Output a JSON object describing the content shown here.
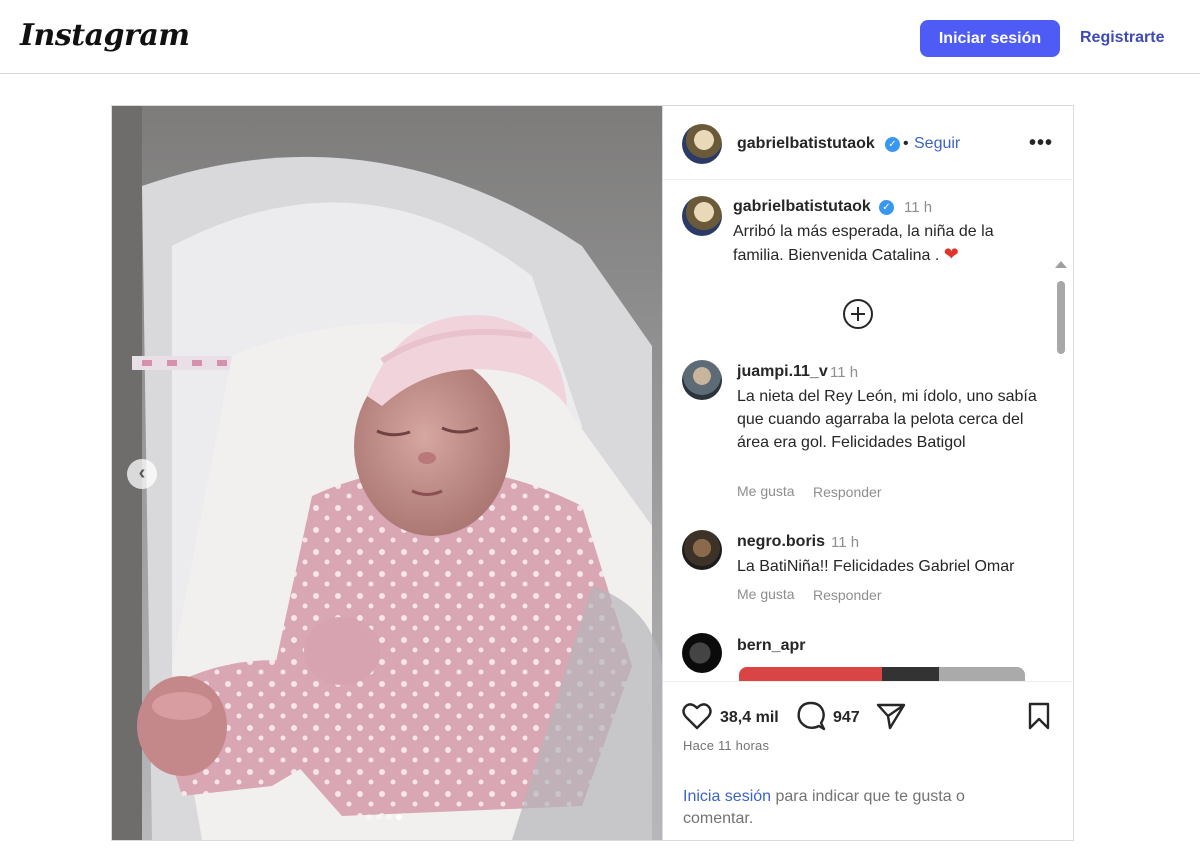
{
  "header": {
    "logo": "Instagram",
    "login_label": "Iniciar sesión",
    "signup_label": "Registrarte"
  },
  "post": {
    "author": "gabrielbatistutaok",
    "follow_label": "Seguir",
    "separator": "•",
    "more_label": "•••",
    "verified_glyph": "✓",
    "caption": {
      "time": "11 h",
      "text": "Arribó la más esperada, la niña de la familia. Bienvenida Catalina .",
      "emoji": "❤"
    },
    "comments": [
      {
        "user": "juampi.11_v",
        "time": "11 h",
        "text": "La nieta del Rey León, mi ídolo, uno sabía que cuando agarraba la pelota cerca del área era gol. Felicidades Batigol",
        "like_label": "Me gusta",
        "reply_label": "Responder"
      },
      {
        "user": "negro.boris",
        "time": "11 h",
        "text": "La BatiNiña!! Felicidades Gabriel Omar",
        "like_label": "Me gusta",
        "reply_label": "Responder"
      },
      {
        "user": "bern_apr"
      }
    ],
    "likes": "38,4 mil",
    "comment_count": "947",
    "posted_ago": "Hace 11 horas",
    "login_prompt": {
      "link": "Inicia sesión",
      "rest": " para indicar que te gusta o comentar."
    },
    "carousel": {
      "prev_label": "‹",
      "slide_count": 4,
      "active_slide": 4
    }
  },
  "colors": {
    "primary_button": "#4f5bf5",
    "link": "#3b63c4",
    "verified": "#3897f0"
  }
}
